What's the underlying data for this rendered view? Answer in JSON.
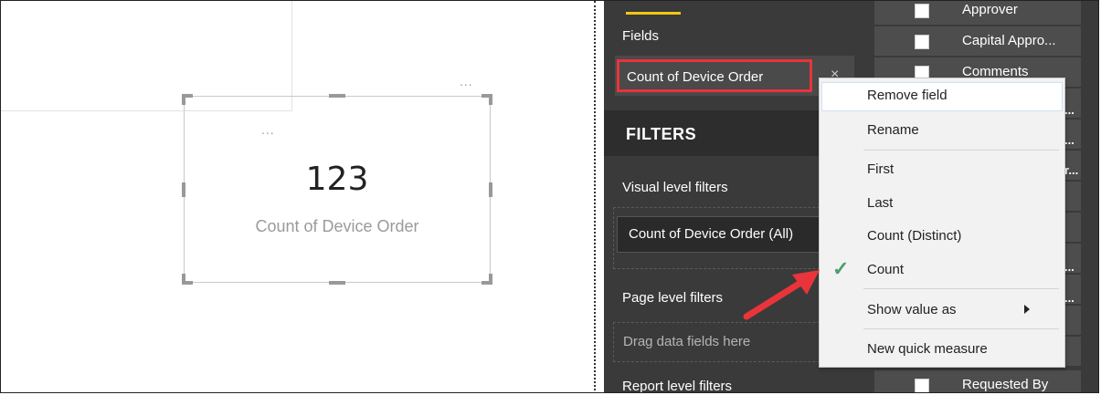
{
  "canvas": {
    "background_more_label": "...",
    "card": {
      "more_label": "...",
      "value": "123",
      "label": "Count of Device Order"
    }
  },
  "visualizations_pane": {
    "fields_title": "Fields",
    "field_pill_label": "Count of Device Order",
    "field_remove_icon": "×",
    "filters_title": "FILTERS",
    "visual_level_filters_title": "Visual level filters",
    "visual_filter_pill_label": "Count of Device Order (All)",
    "page_level_filters_title": "Page level filters",
    "drop_placeholder": "Drag data fields here",
    "report_level_filters_title": "Report level filters"
  },
  "fields_list": {
    "items": [
      {
        "label": "Approver"
      },
      {
        "label": "Capital Appro..."
      },
      {
        "label": "Comments"
      },
      {
        "label": "Requested By"
      }
    ],
    "truncated_marks": [
      "...",
      "...",
      "r...",
      "...",
      "..."
    ]
  },
  "context_menu": {
    "items": [
      {
        "label": "Remove field"
      },
      {
        "label": "Rename"
      },
      {
        "label": "First"
      },
      {
        "label": "Last"
      },
      {
        "label": "Count (Distinct)"
      },
      {
        "label": "Count",
        "checked": true
      },
      {
        "label": "Show value as",
        "submenu": true
      },
      {
        "label": "New quick measure"
      }
    ]
  },
  "colors": {
    "pane_bg": "#3a3a3a",
    "highlight_red": "#e8343a",
    "accent_yellow": "#f2c811",
    "check_green": "#4a9f6b"
  },
  "icons": [
    "more-options-icon",
    "close-icon",
    "checkmark-icon",
    "submenu-arrow-icon",
    "annotation-arrow-icon",
    "checkbox-icon"
  ]
}
